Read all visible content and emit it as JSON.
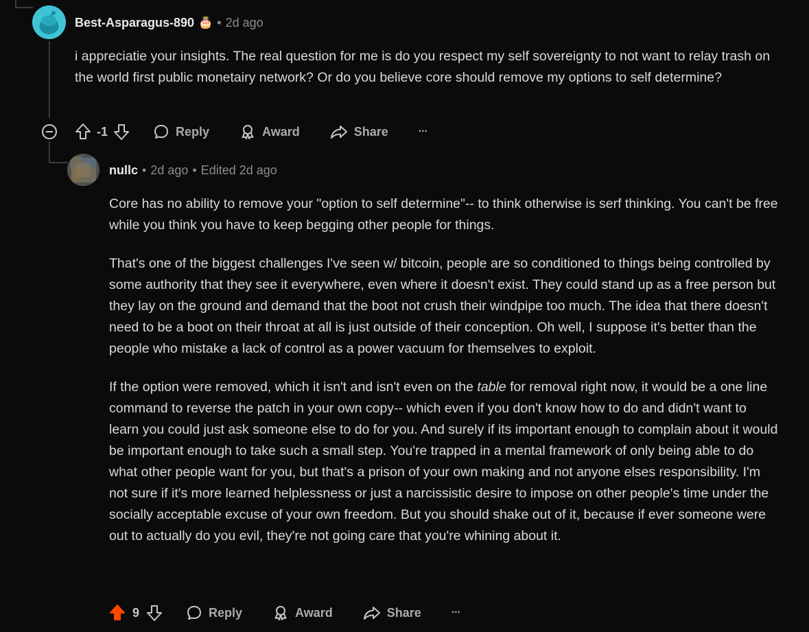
{
  "comment1": {
    "username": "Best-Asparagus-890",
    "flair_emoji": "🎂",
    "time": "2d ago",
    "body": "i appreciatie your insights. The real question for me is do you respect my self sovereignty to not want to relay trash on the world first public monetairy network? Or do you believe core should remove my options to self determine?",
    "votes": "-1",
    "reply_label": "Reply",
    "award_label": "Award",
    "share_label": "Share",
    "more_label": "···"
  },
  "comment2": {
    "username": "nullc",
    "time": "2d ago",
    "edited": "Edited 2d ago",
    "paragraph1": "Core has no ability to remove your \"option to self determine\"-- to think otherwise is serf thinking. You can't be free while you think you have to keep begging other people for things.",
    "paragraph2": "That's one of the biggest challenges I've seen w/ bitcoin, people are so conditioned to things being controlled by some authority that they see it everywhere, even where it doesn't exist. They could stand up as a free person but they lay on the ground and demand that the boot not crush their windpipe too much. The idea that there doesn't need to be a boot on their throat at all is just outside of their conception. Oh well, I suppose it's better than the people who mistake a lack of control as a power vacuum for themselves to exploit.",
    "paragraph3_before": "If the option were removed, which it isn't and isn't even on the ",
    "paragraph3_emphasis": "table",
    "paragraph3_after": " for removal right now, it would be a one line command to reverse the patch in your own copy-- which even if you don't know how to do and didn't want to learn you could just ask someone else to do for you. And surely if its important enough to complain about it would be important enough to take such a small step. You're trapped in a mental framework of only being able to do what other people want for you, but that's a prison of your own making and not anyone elses responsibility. I'm not sure if it's more learned helplessness or just a narcissistic desire to impose on other people's time under the socially acceptable excuse of your own freedom. But you should shake out of it, because if ever someone were out to actually do you evil, they're not going care that you're whining about it.",
    "votes": "9",
    "reply_label": "Reply",
    "award_label": "Award",
    "share_label": "Share",
    "more_label": "···"
  },
  "colors": {
    "upvoted": "#ff4500",
    "avatar1": "#3fc4d6"
  }
}
